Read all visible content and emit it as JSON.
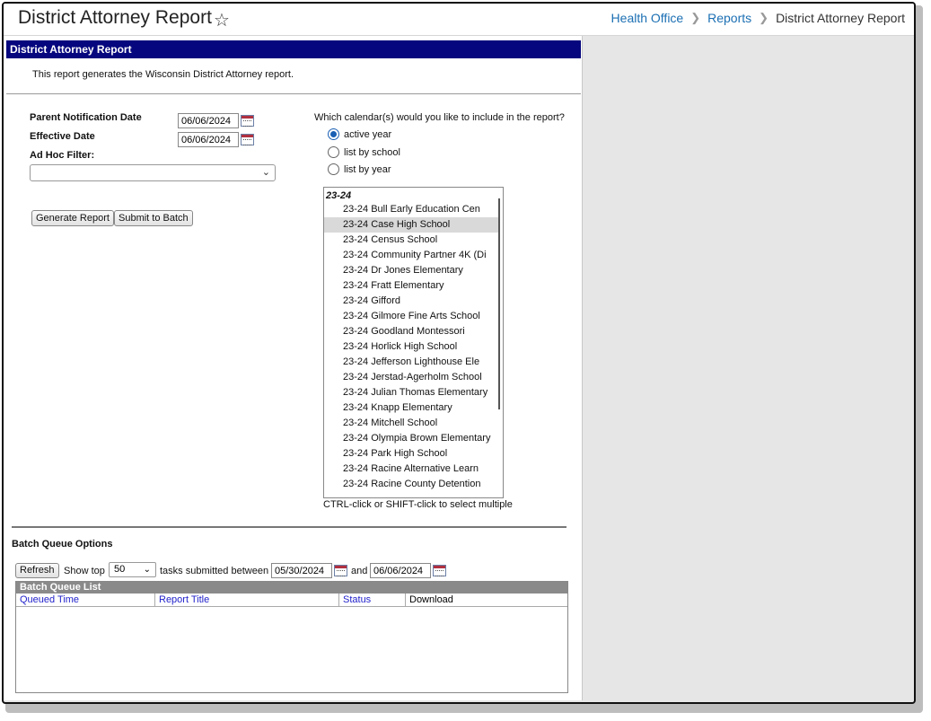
{
  "header": {
    "title": "District Attorney Report",
    "breadcrumb": [
      "Health Office",
      "Reports",
      "District Attorney Report"
    ]
  },
  "panel": {
    "title": "District Attorney Report",
    "description": "This report generates the Wisconsin District Attorney report."
  },
  "form": {
    "parent_notification_label": "Parent Notification Date",
    "parent_notification_value": "06/06/2024",
    "effective_date_label": "Effective Date",
    "effective_date_value": "06/06/2024",
    "adhoc_label": "Ad Hoc Filter:",
    "adhoc_value": "",
    "generate_button": "Generate Report",
    "batch_button": "Submit to Batch"
  },
  "calendar": {
    "question": "Which calendar(s) would you like to include in the report?",
    "options": [
      {
        "label": "active year",
        "selected": true
      },
      {
        "label": "list by school",
        "selected": false
      },
      {
        "label": "list by year",
        "selected": false
      }
    ],
    "group_label": "23-24",
    "items": [
      "23-24 Bull Early Education Cen",
      "23-24 Case High School",
      "23-24 Census School",
      "23-24 Community Partner 4K (Di",
      "23-24 Dr Jones Elementary",
      "23-24 Fratt Elementary",
      "23-24 Gifford",
      "23-24 Gilmore Fine Arts School",
      "23-24 Goodland Montessori",
      "23-24 Horlick High School",
      "23-24 Jefferson Lighthouse Ele",
      "23-24 Jerstad-Agerholm School",
      "23-24 Julian Thomas Elementary",
      "23-24 Knapp Elementary",
      "23-24 Mitchell School",
      "23-24 Olympia Brown Elementary",
      "23-24 Park High School",
      "23-24 Racine Alternative Learn",
      "23-24 Racine County Detention"
    ],
    "selected_item": "23-24 Case High School",
    "hint": "CTRL-click or SHIFT-click to select multiple"
  },
  "batch": {
    "title": "Batch Queue Options",
    "refresh_button": "Refresh",
    "show_top_label": "Show top",
    "show_top_value": "50",
    "between_label": "tasks submitted between",
    "start_date": "05/30/2024",
    "and_label": "and",
    "end_date": "06/06/2024",
    "list_title": "Batch Queue List",
    "columns": [
      "Queued Time",
      "Report Title",
      "Status",
      "Download"
    ]
  }
}
